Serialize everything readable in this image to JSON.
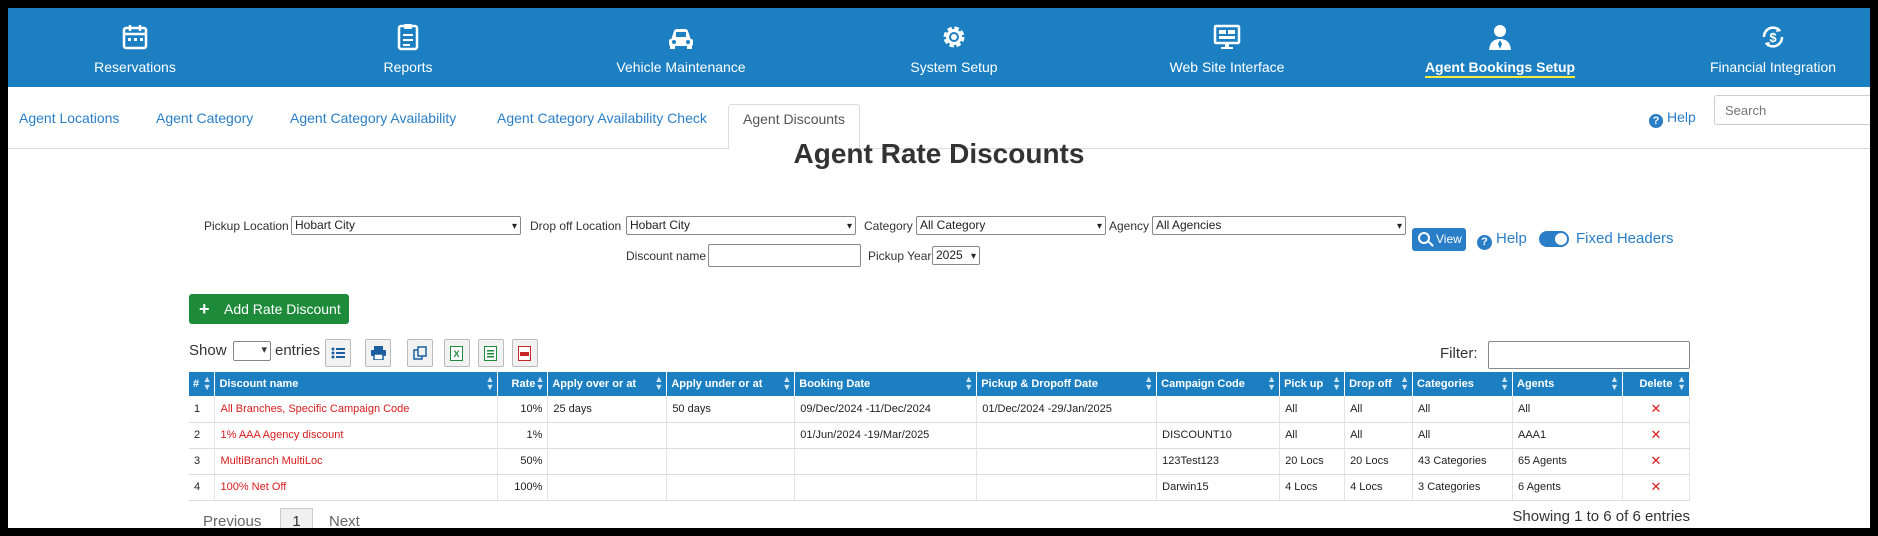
{
  "nav": [
    {
      "label": "Reservations",
      "icon": "calendar-icon"
    },
    {
      "label": "Reports",
      "icon": "clipboard-icon"
    },
    {
      "label": "Vehicle Maintenance",
      "icon": "car-icon"
    },
    {
      "label": "System Setup",
      "icon": "gear-icon"
    },
    {
      "label": "Web Site Interface",
      "icon": "monitor-icon"
    },
    {
      "label": "Agent Bookings Setup",
      "icon": "agent-icon",
      "active": true
    },
    {
      "label": "Financial Integration",
      "icon": "money-icon"
    }
  ],
  "subtabs": [
    "Agent Locations",
    "Agent Category",
    "Agent Category Availability",
    "Agent Category Availability Check",
    "Agent Discounts"
  ],
  "help_label": "Help",
  "search_placeholder": "Search",
  "title": "Agent Rate Discounts",
  "filters": {
    "pickup_label": "Pickup Location",
    "pickup_value": "Hobart City",
    "dropoff_label": "Drop off Location",
    "dropoff_value": "Hobart City",
    "category_label": "Category",
    "category_value": "All Category",
    "agency_label": "Agency",
    "agency_value": "All Agencies",
    "discount_label": "Discount name",
    "year_label": "Pickup Year",
    "year_value": "2025",
    "view_label": "View",
    "help_label": "Help",
    "fixed_headers_label": "Fixed Headers"
  },
  "add_button": "Add Rate Discount",
  "show_label": "Show",
  "entries_label": "entries",
  "filter_label": "Filter:",
  "colors": {
    "primary": "#1b7fc2",
    "add": "#1e8b3a",
    "danger": "#d81b1b"
  },
  "table": {
    "headers": [
      "#",
      "Discount name",
      "Rate",
      "Apply over or at",
      "Apply under or at",
      "Booking Date",
      "Pickup & Dropoff Date",
      "Campaign Code",
      "Pick up",
      "Drop off",
      "Categories",
      "Agents",
      "Delete"
    ],
    "rows": [
      [
        "1",
        "All Branches, Specific Campaign Code",
        "10%",
        "25 days",
        "50 days",
        "09/Dec/2024 -11/Dec/2024",
        "01/Dec/2024 -29/Jan/2025",
        "",
        "All",
        "All",
        "All",
        "All",
        "✕"
      ],
      [
        "2",
        "1% AAA Agency discount",
        "1%",
        "",
        "",
        "01/Jun/2024 -19/Mar/2025",
        "",
        "DISCOUNT10",
        "All",
        "All",
        "All",
        "AAA1",
        "✕"
      ],
      [
        "3",
        "MultiBranch MultiLoc",
        "50%",
        "",
        "",
        "",
        "",
        "123Test123",
        "20 Locs",
        "20 Locs",
        "43 Categories",
        "65 Agents",
        "✕"
      ],
      [
        "4",
        "100% Net Off",
        "100%",
        "",
        "",
        "",
        "",
        "Darwin15",
        "4 Locs",
        "4 Locs",
        "3 Categories",
        "6 Agents",
        "✕"
      ]
    ]
  },
  "pager": {
    "previous": "Previous",
    "page": "1",
    "next": "Next"
  },
  "showing": "Showing 1 to 6 of 6 entries"
}
